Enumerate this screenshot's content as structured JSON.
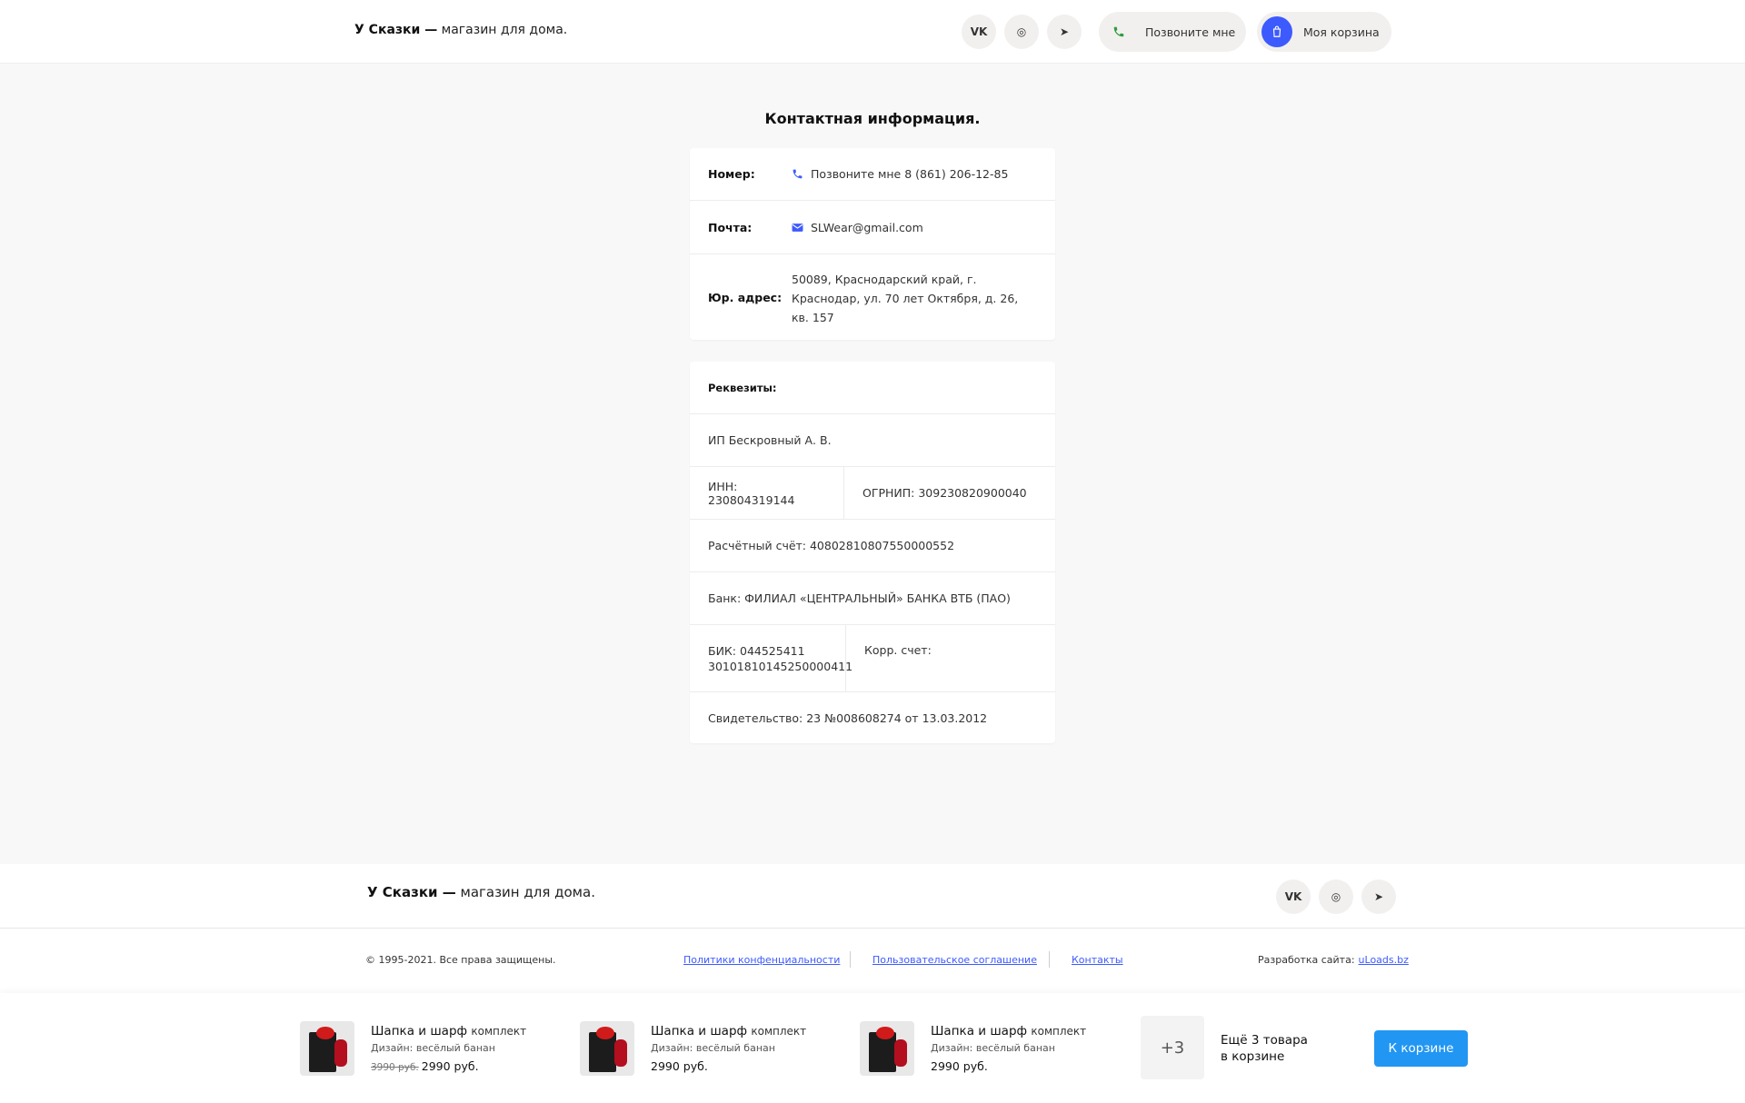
{
  "header": {
    "logo_bold": "У Сказки —",
    "logo_rest": " магазин для дома.",
    "social": [
      {
        "name": "vk-icon",
        "glyph": "VK"
      },
      {
        "name": "instagram-icon",
        "glyph": "◎"
      },
      {
        "name": "telegram-icon",
        "glyph": "➤"
      }
    ],
    "call_label": "Позвоните мне",
    "cart_label": "Моя корзина"
  },
  "contacts": {
    "title": "Контактная информация.",
    "phone_label": "Номер:",
    "phone_value": "Позвоните мне 8 (861) 206-12-85",
    "email_label": "Почта:",
    "email_value": "SLWear@gmail.com",
    "address_label": "Юр. адрес:",
    "address_value": "50089, Краснодарский край, г. Краснодар, ул. 70 лет Октября, д. 26, кв. 157"
  },
  "requisites": {
    "title": "Реквезиты:",
    "owner": "ИП Бескровный А. В.",
    "inn": "ИНН: 230804319144",
    "ogrnip": "ОГРНИП: 309230820900040",
    "account": "Расчётный счёт: 40802810807550000552",
    "bank": "Банк: ФИЛИАЛ «ЦЕНТРАЛЬНЫЙ» БАНКА ВТБ (ПАО)",
    "bik_line1": "БИК: 044525411",
    "bik_line2": "30101810145250000411",
    "corr": "Корр. счет:",
    "certificate": "Свидетельство: 23 №008608274 от 13.03.2012"
  },
  "footer": {
    "logo_bold": "У Сказки —",
    "logo_rest": " магазин для дома.",
    "copyright": "© 1995-2021. Все права защищены.",
    "links": [
      "Политики конфенциальности",
      "Пользовательское соглашение",
      "Контакты"
    ],
    "dev_label": "Разработка сайта:",
    "dev_link": "uLoads.bz"
  },
  "cart_bar": {
    "items": [
      {
        "name": "Шапка и шарф",
        "type": "комплект",
        "design": "Дизайн: весёлый банан",
        "old_price": "3990 руб.",
        "price": "2990 руб."
      },
      {
        "name": "Шапка и шарф",
        "type": "комплект",
        "design": "Дизайн: весёлый банан",
        "old_price": "",
        "price": "2990 руб."
      },
      {
        "name": "Шапка и шарф",
        "type": "комплект",
        "design": "Дизайн: весёлый банан",
        "old_price": "",
        "price": "2990 руб."
      }
    ],
    "more_count": "+3",
    "more_line1": "Ещё 3 товара",
    "more_line2": "в корзине",
    "button": "К корзине"
  },
  "colors": {
    "accent": "#3d5afe",
    "button": "#2196f3",
    "call_icon": "#2e9e3e"
  }
}
